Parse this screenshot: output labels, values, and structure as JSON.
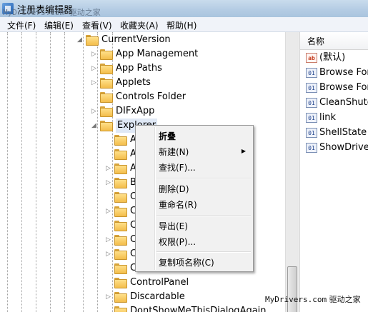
{
  "window": {
    "title": "注册表编辑器",
    "watermark_top": "MyDrivers.com 驱动之家"
  },
  "menu": [
    "文件(F)",
    "编辑(E)",
    "查看(V)",
    "收藏夹(A)",
    "帮助(H)"
  ],
  "tree": {
    "parent": "CurrentVersion",
    "children": [
      "App Management",
      "App Paths",
      "Applets",
      "Controls Folder",
      "DIFxApp",
      "Explorer"
    ],
    "explorer_children_partial": [
      "A",
      "A",
      "A",
      "B",
      "C",
      "C",
      "C",
      "C",
      "C",
      "C"
    ],
    "explorer_children_visible": [
      "ControlPanel",
      "Discardable",
      "DontShowMeThisDialogAgain"
    ]
  },
  "values": {
    "column_header": "名称",
    "items": [
      {
        "icon": "ab",
        "name": "(默认)"
      },
      {
        "icon": "bin",
        "name": "Browse For"
      },
      {
        "icon": "bin",
        "name": "Browse For"
      },
      {
        "icon": "bin",
        "name": "CleanShutdc"
      },
      {
        "icon": "bin",
        "name": "link"
      },
      {
        "icon": "bin",
        "name": "ShellState"
      },
      {
        "icon": "bin",
        "name": "ShowDriveL"
      }
    ]
  },
  "context_menu": {
    "collapse": "折叠",
    "new": "新建(N)",
    "find": "查找(F)...",
    "delete": "删除(D)",
    "rename": "重命名(R)",
    "export": "导出(E)",
    "permissions": "权限(P)...",
    "copy_key_name": "复制项名称(C)"
  },
  "watermark_bottom": {
    "a": "MyDrivers.com",
    "b": "驱动之家"
  }
}
